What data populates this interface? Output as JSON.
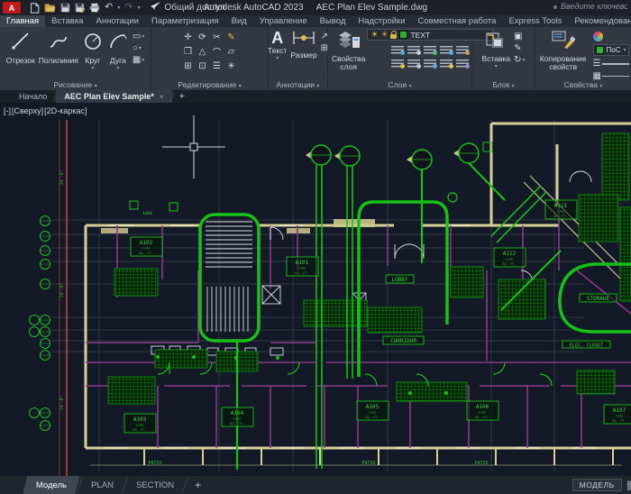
{
  "titlebar": {
    "logo": "A",
    "share": "Общий доступ",
    "app_title": "Autodesk AutoCAD 2023",
    "doc_title": "AEC Plan Elev Sample.dwg",
    "search_hint": "Введите ключевое слово"
  },
  "ribbon": {
    "tabs": [
      "Главная",
      "Вставка",
      "Аннотации",
      "Параметризация",
      "Вид",
      "Управление",
      "Вывод",
      "Надстройки",
      "Совместная работа",
      "Express Tools",
      "Рекомендованные приложения"
    ],
    "draw": {
      "label": "Рисование",
      "line": "Отрезок",
      "polyline": "Полилиния",
      "circle": "Круг",
      "arc": "Дуга"
    },
    "modify": {
      "label": "Редактирование"
    },
    "annotation": {
      "label": "Аннотации",
      "text_letter": "A",
      "text": "Текст",
      "dimension": "Размер"
    },
    "layers": {
      "label": "Слои",
      "properties": "Свойства\nслоя",
      "current_layer": "TEXT"
    },
    "block": {
      "label": "Блок",
      "insert": "Вставка"
    },
    "properties": {
      "label": "Свойства",
      "match": "Копирование\nсвойств",
      "bylayer": "ПоС"
    }
  },
  "file_tabs": {
    "start": "Начало",
    "active_doc": "AEC Plan Elev Sample*",
    "close": "×",
    "plus": "+"
  },
  "viewport_controls": {
    "vp": "[-]",
    "view": "[Сверху]",
    "visual": "[2D-каркас]"
  },
  "drawing": {
    "rooms": {
      "a101": "A101",
      "a102": "A102",
      "a103": "A103",
      "a104": "A104",
      "a105": "A105",
      "a106": "A106",
      "a107": "A107",
      "a111": "A111",
      "a112": "A112",
      "lobby": "LOBBY",
      "corridor": "CORRIDOR",
      "storage": "STORAGE",
      "elec": "ELEC. CLOSET",
      "patio": "PATIO"
    },
    "room_sub": {
      "type": "TYPE",
      "area": "SQ. FT."
    },
    "dim_text": "24'-8\"",
    "top_dim": "4400"
  },
  "layout_tabs": {
    "model": "Модель",
    "plan": "PLAN",
    "section": "SECTION",
    "plus": "+"
  },
  "statusbar": {
    "model_space": "МОДЕЛЬ"
  },
  "colors": {
    "green": "#17c217",
    "wall_yellow": "#d6cf96",
    "magenta": "#8a3a8a",
    "red_line": "#cf4a2c",
    "canvas_bg": "#141927"
  }
}
